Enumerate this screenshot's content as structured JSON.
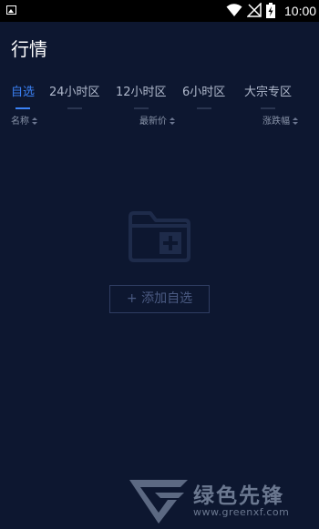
{
  "status_bar": {
    "time": "10:00"
  },
  "header": {
    "title": "行情"
  },
  "tabs": [
    {
      "label": "自选",
      "active": true
    },
    {
      "label": "24小时区",
      "active": false
    },
    {
      "label": "12小时区",
      "active": false
    },
    {
      "label": "6小时区",
      "active": false
    },
    {
      "label": "大宗专区",
      "active": false
    }
  ],
  "columns": {
    "name": "名称",
    "latest_price": "最新价",
    "change_pct": "涨跌幅"
  },
  "empty_state": {
    "icon": "folder-add-icon",
    "add_button_label": "+ 添加自选"
  },
  "watermark": {
    "brand": "绿色先锋",
    "url": "www.greenxf.com"
  },
  "colors": {
    "background": "#0d1730",
    "accent": "#3b82f6",
    "muted_text": "#8893a8",
    "icon_fill": "#1e2b4a"
  }
}
